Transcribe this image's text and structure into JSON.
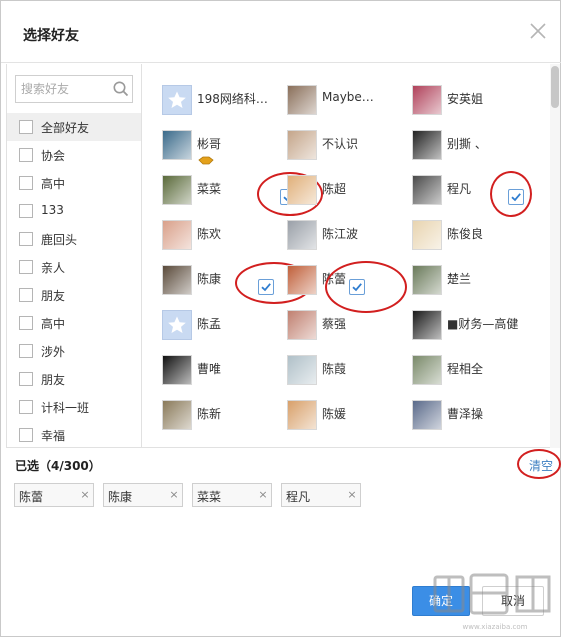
{
  "dialog": {
    "title": "选择好友",
    "close_icon": "close-icon"
  },
  "search": {
    "placeholder": "搜索好友",
    "icon": "search-icon"
  },
  "groups": [
    {
      "label": "全部好友",
      "selected": true
    },
    {
      "label": "协会",
      "selected": false
    },
    {
      "label": "高中",
      "selected": false
    },
    {
      "label": "133",
      "selected": false
    },
    {
      "label": "鹿回头",
      "selected": false
    },
    {
      "label": "亲人",
      "selected": false
    },
    {
      "label": "朋友",
      "selected": false
    },
    {
      "label": "高中",
      "selected": false
    },
    {
      "label": "涉外",
      "selected": false
    },
    {
      "label": "朋友",
      "selected": false
    },
    {
      "label": "计科一班",
      "selected": false
    },
    {
      "label": "幸福",
      "selected": false
    }
  ],
  "friends": [
    {
      "name": "198网络科…",
      "avatar": "default",
      "checked": false,
      "color": "#c9daf2"
    },
    {
      "name": "Maybe…",
      "avatar": "photo",
      "checked": false,
      "color": "#8a6f5a"
    },
    {
      "name": "安英姐",
      "avatar": "photo",
      "checked": false,
      "color": "#b0415a"
    },
    {
      "name": "彬哥",
      "avatar": "photo",
      "checked": false,
      "color": "#3a6a8a",
      "vip": true
    },
    {
      "name": "不认识",
      "avatar": "photo",
      "checked": false,
      "color": "#c4a58a"
    },
    {
      "name": "别撕 、",
      "avatar": "photo",
      "checked": false,
      "color": "#222222"
    },
    {
      "name": "菜菜",
      "avatar": "photo",
      "checked": true,
      "color": "#5a6a3a"
    },
    {
      "name": "陈超",
      "avatar": "photo",
      "checked": false,
      "color": "#e0b07a"
    },
    {
      "name": "程凡",
      "avatar": "photo",
      "checked": true,
      "color": "#4a4a4a"
    },
    {
      "name": "陈欢",
      "avatar": "photo",
      "checked": false,
      "color": "#d9a08a"
    },
    {
      "name": "陈江波",
      "avatar": "photo",
      "checked": false,
      "color": "#9aa0a8"
    },
    {
      "name": "陈俊良",
      "avatar": "photo",
      "checked": false,
      "color": "#e8d4b0"
    },
    {
      "name": "陈康",
      "avatar": "photo",
      "checked": true,
      "color": "#5a4a3a"
    },
    {
      "name": "陈蕾",
      "avatar": "photo",
      "checked": true,
      "color": "#c0603a"
    },
    {
      "name": "楚兰",
      "avatar": "photo",
      "checked": false,
      "color": "#6a7a5a"
    },
    {
      "name": "陈孟",
      "avatar": "default",
      "checked": false,
      "color": "#c9daf2"
    },
    {
      "name": "蔡强",
      "avatar": "photo",
      "checked": false,
      "color": "#c08070"
    },
    {
      "name": "■财务—高健",
      "avatar": "photo",
      "checked": false,
      "color": "#1a1a1a"
    },
    {
      "name": "曹唯",
      "avatar": "photo",
      "checked": false,
      "color": "#111111"
    },
    {
      "name": "陈葭",
      "avatar": "photo",
      "checked": false,
      "color": "#b0c0c8"
    },
    {
      "name": "程相全",
      "avatar": "photo",
      "checked": false,
      "color": "#7a8a6a"
    },
    {
      "name": "陈新",
      "avatar": "photo",
      "checked": false,
      "color": "#8a7a5a"
    },
    {
      "name": "陈媛",
      "avatar": "photo",
      "checked": false,
      "color": "#d8a06a"
    },
    {
      "name": "曹泽操",
      "avatar": "photo",
      "checked": false,
      "color": "#5a6a8a"
    }
  ],
  "selection": {
    "label": "已选（4/300）",
    "clear_label": "清空",
    "chips": [
      {
        "label": "陈蕾",
        "remove": "×"
      },
      {
        "label": "陈康",
        "remove": "×"
      },
      {
        "label": "菜菜",
        "remove": "×"
      },
      {
        "label": "程凡",
        "remove": "×"
      }
    ]
  },
  "buttons": {
    "confirm_label": "确定",
    "cancel_label": "取消"
  },
  "colors": {
    "accent": "#3b8ee6",
    "link": "#3d7fc1",
    "annotation": "#d21f1f"
  }
}
